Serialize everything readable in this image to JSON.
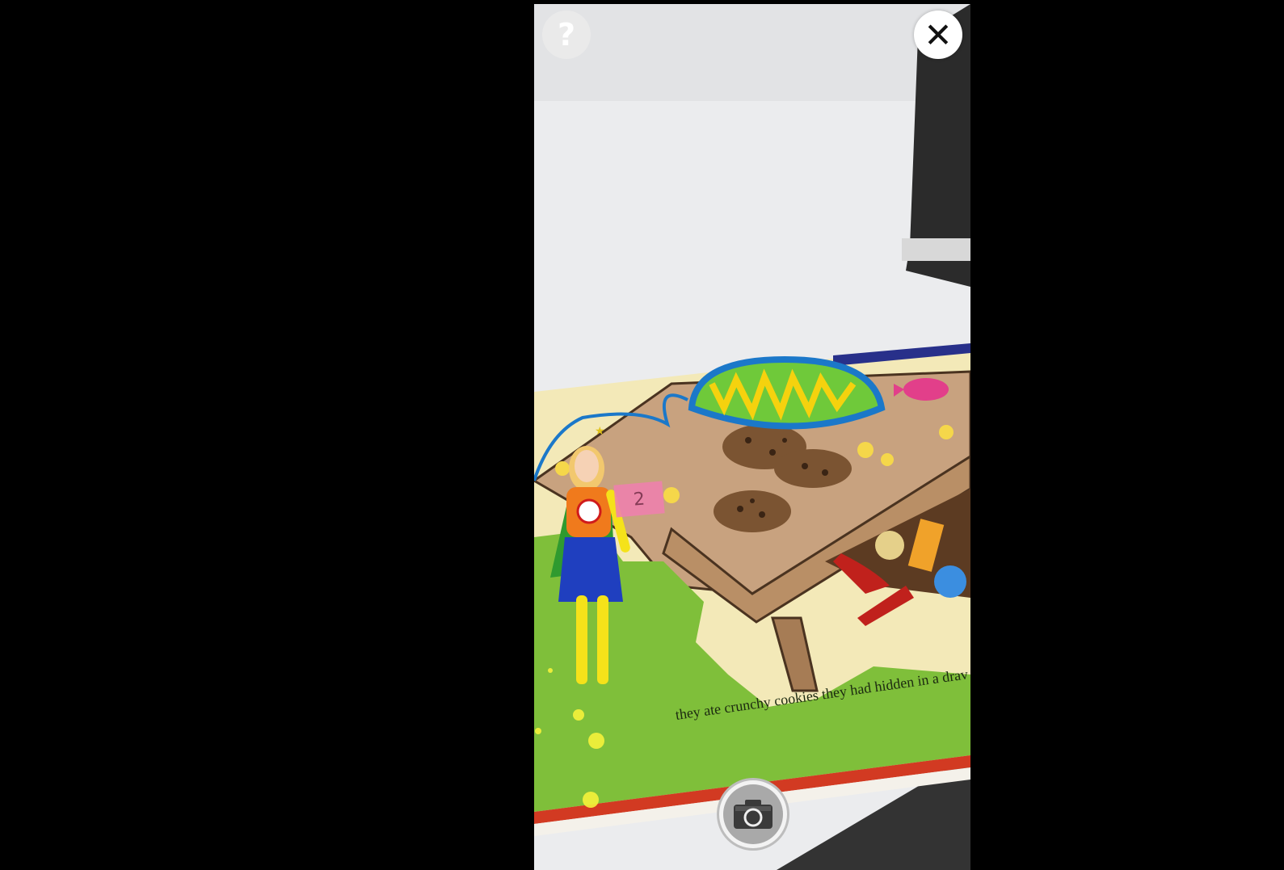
{
  "controls": {
    "help_label": "?",
    "close_label": "✕",
    "capture_icon": "camera-icon"
  },
  "scene": {
    "caption": "they ate crunchy cookies they had hidden in a drav",
    "note_number": "2",
    "emblem": "𝄞"
  },
  "colors": {
    "grass": "#7fbf3a",
    "table": "#c8a27f",
    "cape": "#2f9a2f",
    "suit": "#f07a1c",
    "skirt": "#1f3fbf",
    "legs": "#f5e21a"
  }
}
